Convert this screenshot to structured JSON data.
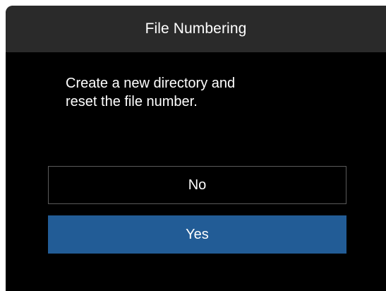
{
  "dialog": {
    "title": "File Numbering",
    "message": "Create a new directory and\nreset the file number.",
    "options": [
      {
        "label": "No",
        "selected": false
      },
      {
        "label": "Yes",
        "selected": true
      }
    ]
  },
  "colors": {
    "background": "#000000",
    "title_bar": "#2a2a2a",
    "text": "#ffffff",
    "selected_option": "#225c96",
    "option_border": "#5a5a5a"
  }
}
